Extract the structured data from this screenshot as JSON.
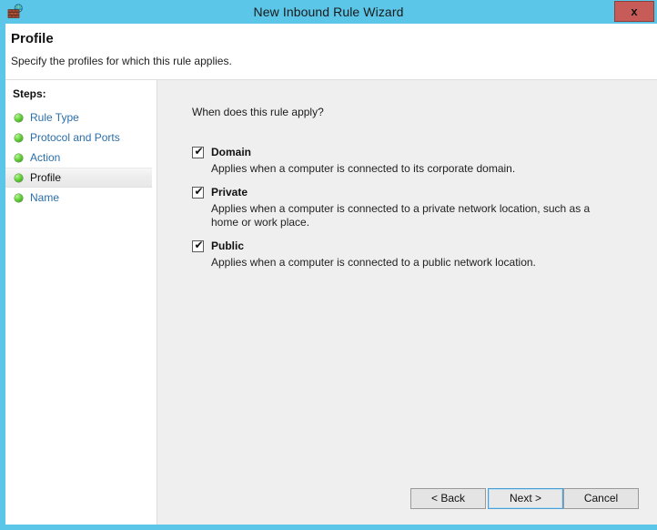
{
  "window": {
    "title": "New Inbound Rule Wizard",
    "icon": "firewall-globe-icon",
    "close_label": "x",
    "frame_color": "#5bc6e8"
  },
  "header": {
    "title": "Profile",
    "subtitle": "Specify the profiles for which this rule applies."
  },
  "sidebar": {
    "heading": "Steps:",
    "items": [
      {
        "label": "Rule Type",
        "current": false
      },
      {
        "label": "Protocol and Ports",
        "current": false
      },
      {
        "label": "Action",
        "current": false
      },
      {
        "label": "Profile",
        "current": true
      },
      {
        "label": "Name",
        "current": false
      }
    ]
  },
  "main": {
    "question": "When does this rule apply?",
    "options": [
      {
        "label": "Domain",
        "checked": true,
        "check_glyph": "✔",
        "description": "Applies when a computer is connected to its corporate domain."
      },
      {
        "label": "Private",
        "checked": true,
        "check_glyph": "✔",
        "description": "Applies when a computer is connected to a private network location, such as a home or work place."
      },
      {
        "label": "Public",
        "checked": true,
        "check_glyph": "✔",
        "description": "Applies when a computer is connected to a public network location."
      }
    ]
  },
  "footer": {
    "back_label": "< Back",
    "next_label": "Next >",
    "cancel_label": "Cancel"
  }
}
